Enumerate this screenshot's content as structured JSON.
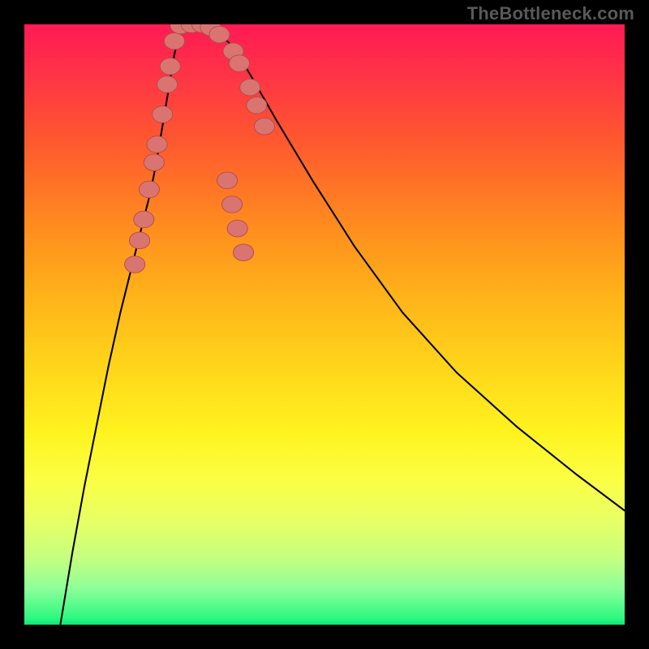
{
  "watermark": {
    "text": "TheBottleneck.com"
  },
  "colors": {
    "frame": "#000000",
    "curve": "#000000",
    "marker_fill": "#d97470",
    "marker_stroke": "#b24a46"
  },
  "chart_data": {
    "type": "line",
    "title": "",
    "xlabel": "",
    "ylabel": "",
    "xlim": [
      0,
      100
    ],
    "ylim": [
      0,
      100
    ],
    "note": "No axis ticks or numeric labels are rendered; values below are estimated from curve geometry in plot-percent coordinates (0,0 = top-left).",
    "series": [
      {
        "name": "bottleneck-curve",
        "x": [
          6,
          8,
          10,
          12,
          14,
          16,
          18,
          20,
          21,
          22,
          23,
          24,
          25,
          26,
          27.5,
          29.5,
          32,
          35,
          38,
          42,
          48,
          55,
          63,
          72,
          82,
          92,
          100
        ],
        "y": [
          0,
          12,
          23,
          33,
          43,
          52,
          60,
          68,
          72,
          77,
          83,
          89,
          95,
          99.5,
          100,
          100,
          99,
          96,
          91,
          84,
          74,
          63,
          52,
          42,
          33,
          25,
          19
        ]
      }
    ],
    "markers": {
      "name": "highlighted-points",
      "points": [
        {
          "x": 18.4,
          "y": 60.0
        },
        {
          "x": 19.2,
          "y": 64.0
        },
        {
          "x": 19.9,
          "y": 67.5
        },
        {
          "x": 20.8,
          "y": 72.5
        },
        {
          "x": 21.6,
          "y": 77.0
        },
        {
          "x": 22.1,
          "y": 80.0
        },
        {
          "x": 23.0,
          "y": 85.0
        },
        {
          "x": 23.8,
          "y": 90.0
        },
        {
          "x": 24.3,
          "y": 93.0
        },
        {
          "x": 25.0,
          "y": 97.2
        },
        {
          "x": 26.0,
          "y": 99.8
        },
        {
          "x": 27.8,
          "y": 100.0
        },
        {
          "x": 29.6,
          "y": 100.0
        },
        {
          "x": 31.0,
          "y": 99.5
        },
        {
          "x": 32.5,
          "y": 98.3
        },
        {
          "x": 34.8,
          "y": 95.5
        },
        {
          "x": 35.8,
          "y": 93.5
        },
        {
          "x": 37.6,
          "y": 89.5
        },
        {
          "x": 38.7,
          "y": 86.5
        },
        {
          "x": 40.0,
          "y": 83.0
        },
        {
          "x": 36.5,
          "y": 62.0
        },
        {
          "x": 35.5,
          "y": 66.0
        },
        {
          "x": 34.6,
          "y": 70.0
        },
        {
          "x": 33.8,
          "y": 74.0
        }
      ],
      "radius_percent": 1.7
    }
  }
}
